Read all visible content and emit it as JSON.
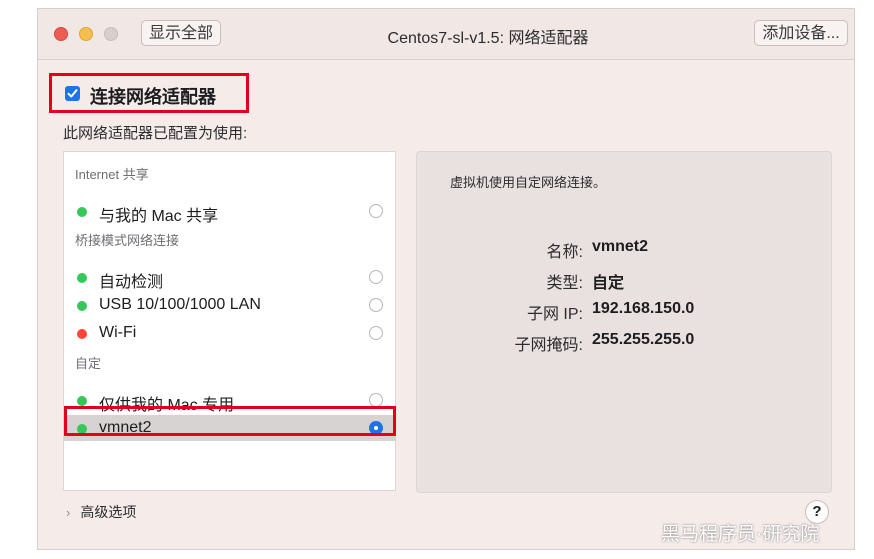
{
  "window": {
    "title": "Centos7-sl-v1.5: 网络适配器",
    "show_all_label": "显示全部",
    "add_device_label": "添加设备..."
  },
  "connect": {
    "checked": true,
    "label": "连接网络适配器"
  },
  "config_label": "此网络适配器已配置为使用:",
  "list": {
    "sections": [
      {
        "header": "Internet 共享",
        "items": [
          {
            "label": "与我的 Mac 共享",
            "status_color": "#34c759",
            "selected": false
          }
        ]
      },
      {
        "header": "桥接模式网络连接",
        "items": [
          {
            "label": "自动检测",
            "status_color": "#34c759",
            "selected": false
          },
          {
            "label": "USB 10/100/1000 LAN",
            "status_color": "#34c759",
            "selected": false
          },
          {
            "label": "Wi-Fi",
            "status_color": "#ff453a",
            "selected": false
          }
        ]
      },
      {
        "header": "自定",
        "items": [
          {
            "label": "仅供我的 Mac 专用",
            "status_color": "#34c759",
            "selected": false
          },
          {
            "label": "vmnet2",
            "status_color": "#34c759",
            "selected": true
          }
        ]
      }
    ]
  },
  "detail": {
    "description": "虚拟机使用自定网络连接。",
    "name_key": "名称:",
    "name_value": "vmnet2",
    "type_key": "类型:",
    "type_value": "自定",
    "subnet_key": "子网 IP:",
    "subnet_value": "192.168.150.0",
    "mask_key": "子网掩码:",
    "mask_value": "255.255.255.0"
  },
  "advanced_label": "高级选项",
  "help_label": "?",
  "watermark": "黑马程序员·研究院",
  "colors": {
    "accent": "#1f73e8",
    "highlight_box": "#e3001b",
    "status_green": "#34c759",
    "status_red": "#ff453a"
  }
}
